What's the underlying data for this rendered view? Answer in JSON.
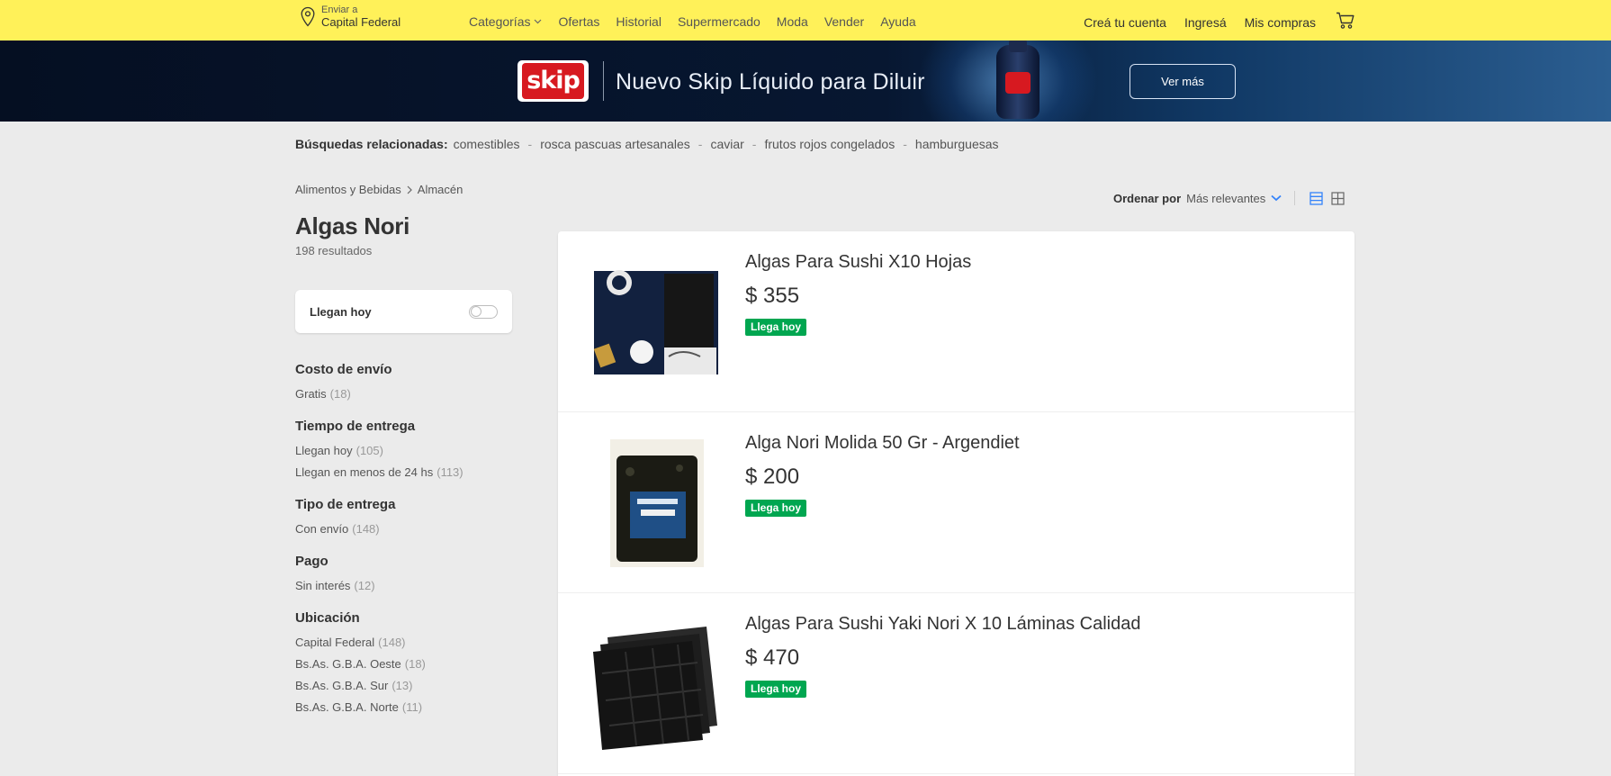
{
  "header": {
    "location": {
      "small": "Enviar a",
      "big": "Capital Federal"
    },
    "nav": [
      {
        "label": "Categorías",
        "dropdown": true
      },
      {
        "label": "Ofertas"
      },
      {
        "label": "Historial"
      },
      {
        "label": "Supermercado"
      },
      {
        "label": "Moda"
      },
      {
        "label": "Vender"
      },
      {
        "label": "Ayuda"
      }
    ],
    "account": {
      "create": "Creá tu cuenta",
      "login": "Ingresá",
      "purchases": "Mis compras"
    }
  },
  "banner": {
    "logo": "skip",
    "title": "Nuevo Skip Líquido para Diluir",
    "button": "Ver más"
  },
  "related": {
    "label": "Búsquedas relacionadas:",
    "items": [
      "comestibles",
      "rosca pascuas artesanales",
      "caviar",
      "frutos rojos congelados",
      "hamburguesas"
    ]
  },
  "breadcrumb": [
    "Alimentos y Bebidas",
    "Almacén"
  ],
  "search": {
    "title": "Algas Nori",
    "results": "198 resultados"
  },
  "toggle": {
    "label": "Llegan hoy",
    "on": false
  },
  "filters": [
    {
      "title": "Costo de envío",
      "items": [
        {
          "label": "Gratis",
          "count": "(18)"
        }
      ]
    },
    {
      "title": "Tiempo de entrega",
      "items": [
        {
          "label": "Llegan hoy",
          "count": "(105)"
        },
        {
          "label": "Llegan en menos de 24 hs",
          "count": "(113)"
        }
      ]
    },
    {
      "title": "Tipo de entrega",
      "items": [
        {
          "label": "Con envío",
          "count": "(148)"
        }
      ]
    },
    {
      "title": "Pago",
      "items": [
        {
          "label": "Sin interés",
          "count": "(12)"
        }
      ]
    },
    {
      "title": "Ubicación",
      "items": [
        {
          "label": "Capital Federal",
          "count": "(148)"
        },
        {
          "label": "Bs.As. G.B.A. Oeste",
          "count": "(18)"
        },
        {
          "label": "Bs.As. G.B.A. Sur",
          "count": "(13)"
        },
        {
          "label": "Bs.As. G.B.A. Norte",
          "count": "(11)"
        }
      ]
    }
  ],
  "sort": {
    "label": "Ordenar por",
    "value": "Más relevantes"
  },
  "products": [
    {
      "title": "Algas Para Sushi X10 Hojas",
      "price": "$ 355",
      "badge": "Llega hoy"
    },
    {
      "title": "Alga Nori Molida 50 Gr - Argendiet",
      "price": "$ 200",
      "badge": "Llega hoy"
    },
    {
      "title": "Algas Para Sushi Yaki Nori X 10 Láminas Calidad",
      "price": "$ 470",
      "badge": "Llega hoy"
    }
  ],
  "colors": {
    "header": "#fff159",
    "badge": "#00a650",
    "accent": "#3483fa"
  },
  "icons": [
    "location-pin-icon",
    "chevron-down-icon",
    "cart-icon",
    "chevron-right-icon",
    "list-view-icon",
    "grid-view-icon"
  ]
}
